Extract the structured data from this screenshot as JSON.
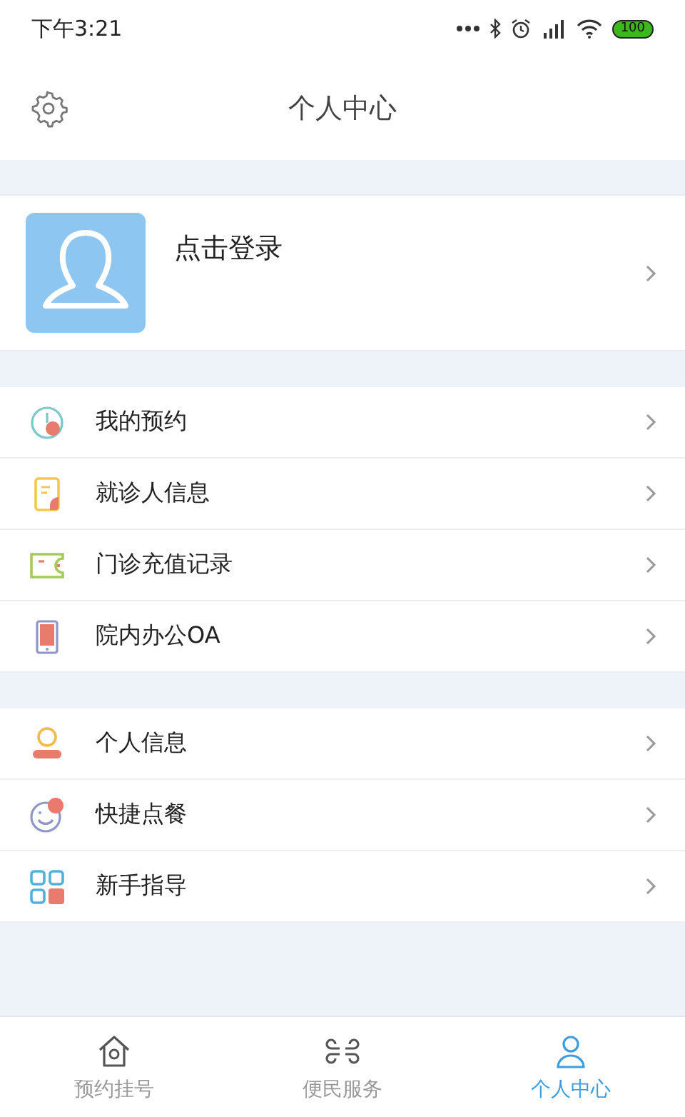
{
  "status_bar": {
    "time": "下午3:21",
    "battery": "100"
  },
  "header": {
    "title": "个人中心"
  },
  "profile": {
    "login_label": "点击登录"
  },
  "menu_groups": [
    [
      {
        "label": "我的预约"
      },
      {
        "label": "就诊人信息"
      },
      {
        "label": "门诊充值记录"
      },
      {
        "label": "院内办公OA"
      }
    ],
    [
      {
        "label": "个人信息"
      },
      {
        "label": "快捷点餐"
      },
      {
        "label": "新手指导"
      }
    ]
  ],
  "tabs": [
    {
      "label": "预约挂号",
      "selected": false
    },
    {
      "label": "便民服务",
      "selected": false
    },
    {
      "label": "个人中心",
      "selected": true
    }
  ]
}
